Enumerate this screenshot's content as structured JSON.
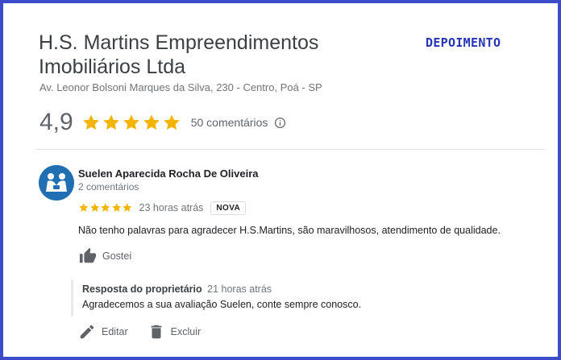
{
  "business": {
    "name": "H.S. Martins Empreendimentos Imobiliários Ltda",
    "address": "Av. Leonor Bolsoni Marques da Silva, 230 - Centro, Poá - SP",
    "rating": "4,9",
    "stars": 5,
    "comments_count": "50 comentários"
  },
  "corner_label": "DEPOIMENTO",
  "review": {
    "author": "Suelen Aparecida Rocha De Oliveira",
    "author_meta": "2 comentários",
    "stars": 5,
    "time": "23 horas atrás",
    "badge": "NOVA",
    "text": "Não tenho palavras para agradecer H.S.Martins, são maravilhosos, atendimento de qualidade.",
    "like_label": "Gostei"
  },
  "reply": {
    "owner_label": "Resposta do proprietário",
    "time": "21 horas atrás",
    "text": "Agradecemos a sua avaliação Suelen, conte sempre conosco."
  },
  "actions": {
    "edit_label": "Editar",
    "delete_label": "Excluir"
  },
  "colors": {
    "frame": "#3c4bc8",
    "star": "#f4b400",
    "corner_label": "#2734b8",
    "avatar": "#1f6fb2"
  },
  "icons": {
    "star": "star-icon",
    "info": "info-icon",
    "like": "thumbs-up-icon",
    "edit": "pencil-icon",
    "delete": "trash-icon"
  }
}
